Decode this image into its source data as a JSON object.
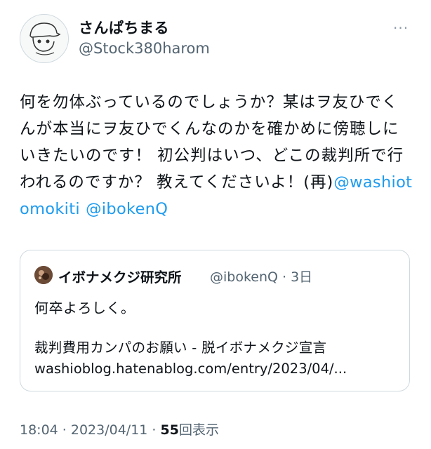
{
  "author": {
    "display_name": "さんぱちまる",
    "handle": "@Stock380harom"
  },
  "more_icon": "more-horizontal-icon",
  "tweet": {
    "text": "何を勿体ぶっているのでしょうか？某はヲ友ひでくんが本当にヲ友ひでくんなのかを確かめに傍聴しにいきたいのです！ 初公判はいつ、どこの裁判所で行われるのですか？ 教えてくださいよ！(再)",
    "mentions": [
      "@washiotomokiti",
      "@ibokenQ"
    ],
    "mention_separator": " "
  },
  "quote": {
    "display_name": "イボナメクジ研究所",
    "handle_time": "@ibokenQ · 3日",
    "text": "何卒よろしく。",
    "link_title": "裁判費用カンパのお願い - 脱イボナメクジ宣言",
    "link_url": "washioblog.hatenablog.com/entry/2023/04/..."
  },
  "footer": {
    "time_date": "18:04 · 2023/04/11 · ",
    "views_count": "55",
    "views_label": "回表示"
  },
  "colors": {
    "link": "#1d9bf0",
    "secondary_text": "#536471",
    "border": "#cfd9de"
  }
}
